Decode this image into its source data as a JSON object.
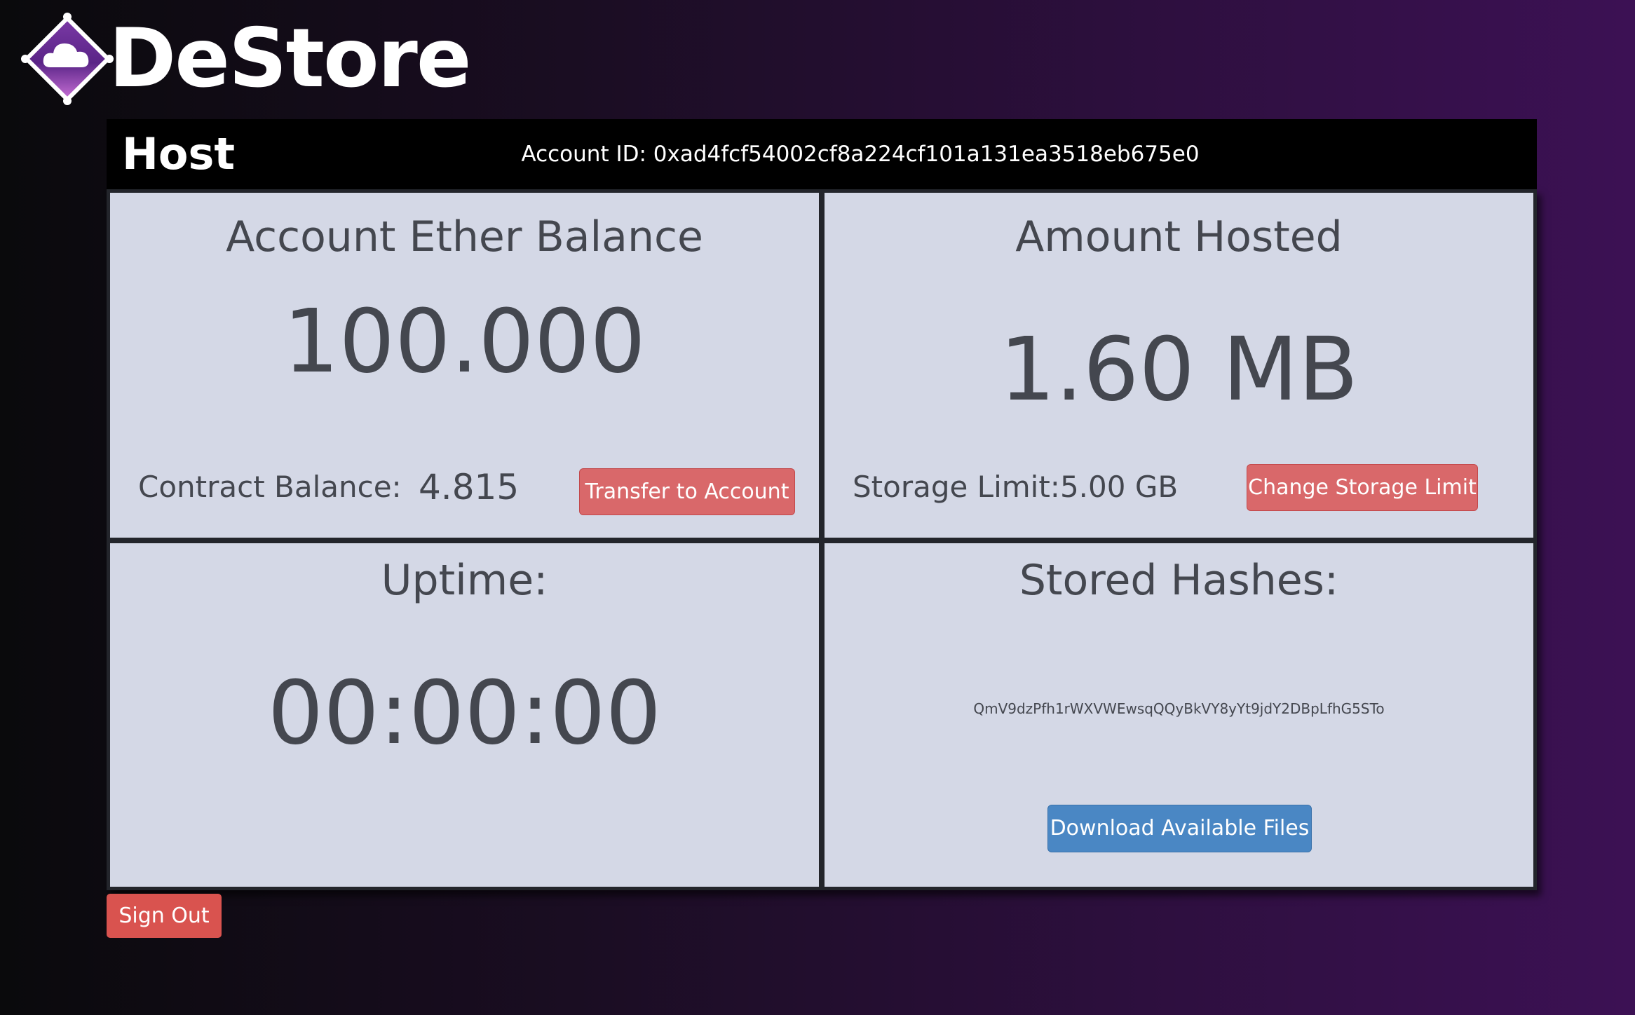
{
  "brand": {
    "name": "DeStore"
  },
  "header": {
    "title": "Host",
    "account_label": "Account ID:",
    "account_id": "0xad4fcf54002cf8a224cf101a131ea3518eb675e0"
  },
  "balance_panel": {
    "title": "Account Ether Balance",
    "value": "100.000",
    "contract_label": "Contract Balance:",
    "contract_value": "4.815",
    "transfer_button": "Transfer to Account"
  },
  "hosted_panel": {
    "title": "Amount Hosted",
    "value": "1.60 MB",
    "limit_label": "Storage Limit:",
    "limit_value": "5.00 GB",
    "change_button": "Change Storage Limit"
  },
  "uptime_panel": {
    "title": "Uptime:",
    "value": "00:00:00"
  },
  "hashes_panel": {
    "title": "Stored Hashes:",
    "hashes": [
      "QmV9dzPfh1rWXVWEwsqQQyBkVY8yYt9jdY2DBpLfhG5STo"
    ],
    "download_button": "Download Available Files"
  },
  "signout_button": "Sign Out",
  "colors": {
    "panel_bg": "#d4d8e6",
    "panel_text": "#44474f",
    "button_red": "#d9686a",
    "button_blue": "#4a87c4",
    "signout_red": "#d9534f",
    "header_bg": "#000000"
  },
  "icons": {
    "logo": "cloud-diamond-logo-icon"
  }
}
